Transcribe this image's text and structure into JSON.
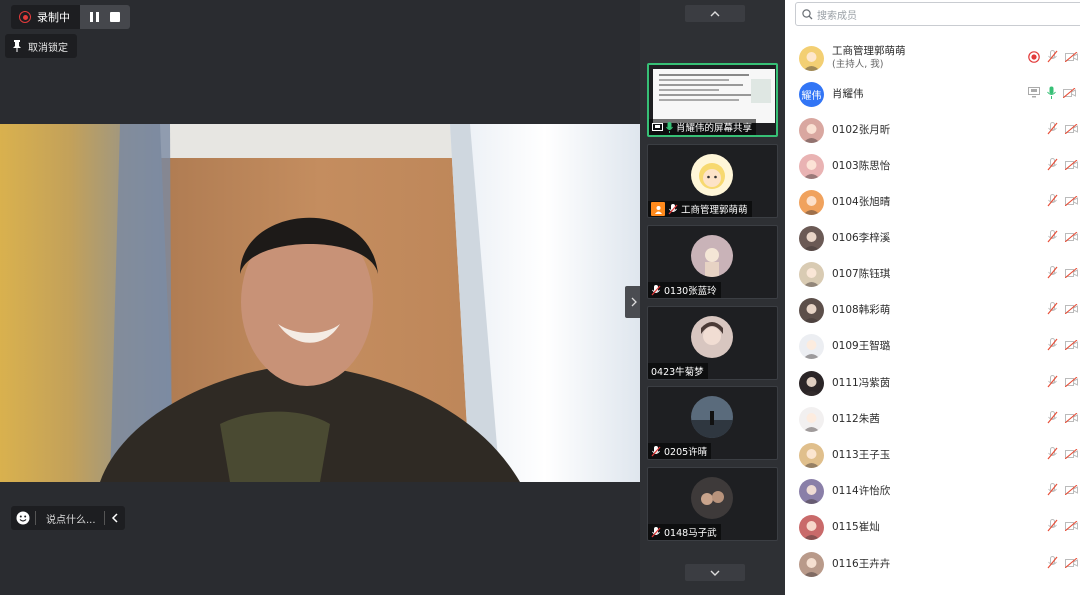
{
  "recording": {
    "status_label": "录制中"
  },
  "unlock": {
    "label": "取消锁定"
  },
  "chat": {
    "placeholder": "说点什么..."
  },
  "thumbnails": [
    {
      "label": "肖耀伟的屏幕共享",
      "type": "screen-share",
      "active": true
    },
    {
      "label": "工商管理郭萌萌",
      "type": "host",
      "avatar_color": "#f6d36a"
    },
    {
      "label": "0130张蓝玲",
      "avatar_color": "#c9b3b8"
    },
    {
      "label": "0423牛菊梦",
      "avatar_color": "#d8c6c0"
    },
    {
      "label": "0205许晴",
      "avatar_color": "#4b5a6a"
    },
    {
      "label": "0148马子武",
      "avatar_color": "#3e3a3a"
    }
  ],
  "panel": {
    "search_placeholder": "搜索成员",
    "members": [
      {
        "name": "工商管理郭萌萌",
        "sub": "(主持人, 我)",
        "avatar_color": "#f3cf73",
        "recording": true
      },
      {
        "name": "肖耀伟",
        "avatar_text": "耀伟",
        "screen_share": true,
        "mic_on": true
      },
      {
        "name": "0102张月昕",
        "avatar_color": "#d9a7a0"
      },
      {
        "name": "0103陈思怡",
        "avatar_color": "#e9b3b3"
      },
      {
        "name": "0104张旭晴",
        "avatar_color": "#f0a25d"
      },
      {
        "name": "0106李梓溪",
        "avatar_color": "#6b5a55"
      },
      {
        "name": "0107陈钰琪",
        "avatar_color": "#d9cbb3"
      },
      {
        "name": "0108韩彩萌",
        "avatar_color": "#5c4f4a"
      },
      {
        "name": "0109王智璐",
        "avatar_color": "#eceef2"
      },
      {
        "name": "0111冯紫茵",
        "avatar_color": "#2b2527"
      },
      {
        "name": "0112朱茜",
        "avatar_color": "#f2f0f0"
      },
      {
        "name": "0113王子玉",
        "avatar_color": "#e0bf8c"
      },
      {
        "name": "0114许怡欣",
        "avatar_color": "#8a7fa8"
      },
      {
        "name": "0115崔灿",
        "avatar_color": "#c96a6a"
      },
      {
        "name": "0116王卉卉",
        "avatar_color": "#b99a8a"
      }
    ]
  }
}
